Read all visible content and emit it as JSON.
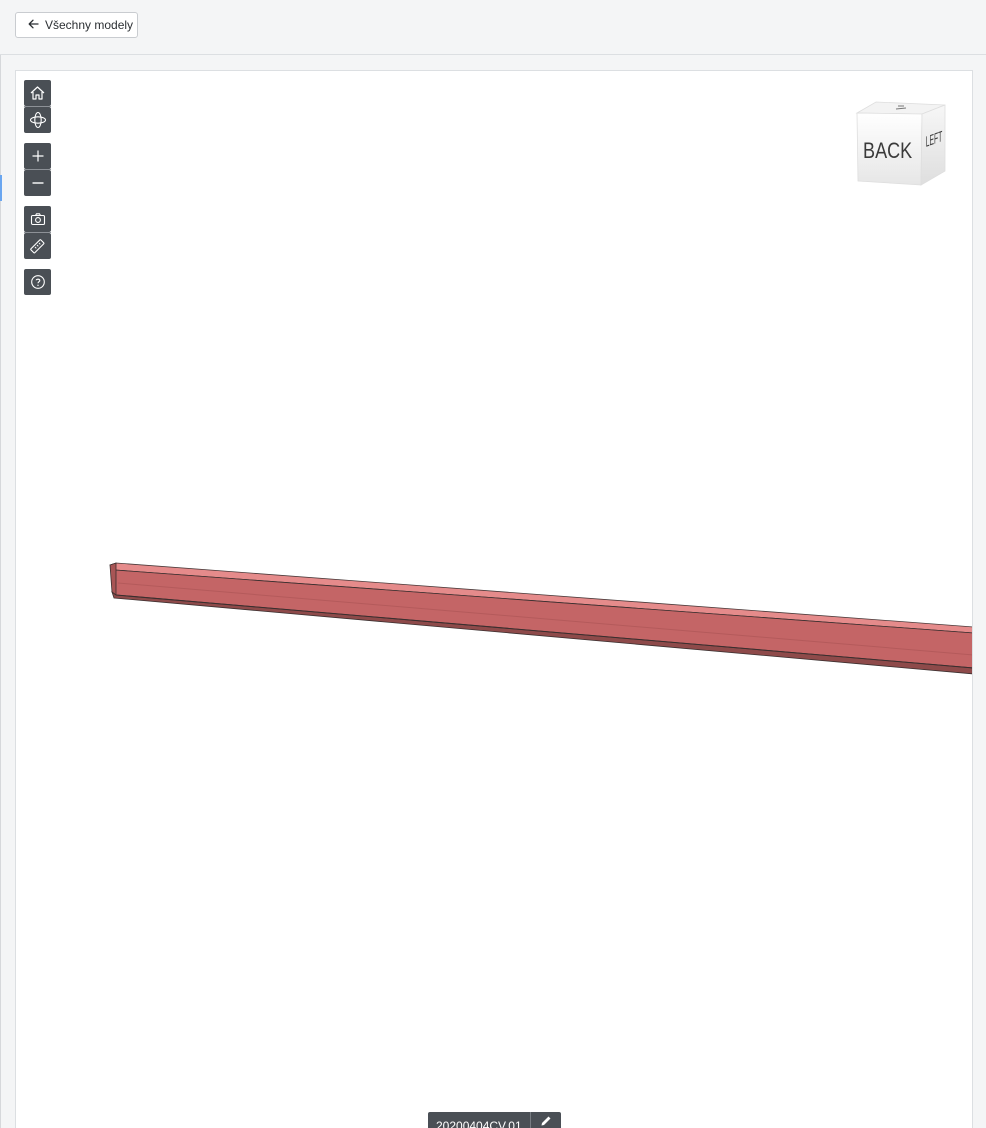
{
  "header": {
    "back_label": "Všechny modely",
    "back_icon": "arrow-left-icon"
  },
  "toolbar": {
    "buttons": [
      {
        "name": "home",
        "icon": "home-icon"
      },
      {
        "name": "orbit",
        "icon": "orbit-icon"
      },
      {
        "name": "zoom-in",
        "icon": "plus-icon"
      },
      {
        "name": "zoom-out",
        "icon": "minus-icon"
      },
      {
        "name": "screenshot",
        "icon": "camera-icon"
      },
      {
        "name": "measure",
        "icon": "ruler-icon"
      },
      {
        "name": "help",
        "icon": "help-icon"
      }
    ]
  },
  "viewcube": {
    "front_face": "BACK",
    "side_face": "LEFT"
  },
  "model": {
    "name": "20200404CV.01",
    "edit_icon": "pencil-icon",
    "beam_color": "#c46566"
  },
  "colors": {
    "toolbar_bg": "#4a4f55",
    "accent": "#6aa6f0"
  }
}
